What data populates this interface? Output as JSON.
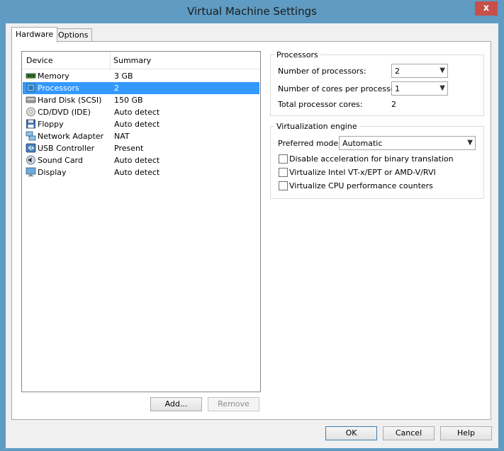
{
  "window": {
    "title": "Virtual Machine Settings",
    "close_glyph": "x"
  },
  "tabs": [
    {
      "label": "Hardware"
    },
    {
      "label": "Options"
    }
  ],
  "device_list": {
    "col_device": "Device",
    "col_summary": "Summary",
    "rows": [
      {
        "device": "Memory",
        "summary": "3 GB",
        "icon": "memory-icon"
      },
      {
        "device": "Processors",
        "summary": "2",
        "icon": "processor-icon"
      },
      {
        "device": "Hard Disk (SCSI)",
        "summary": "150 GB",
        "icon": "hard-disk-icon"
      },
      {
        "device": "CD/DVD (IDE)",
        "summary": "Auto detect",
        "icon": "cd-dvd-icon"
      },
      {
        "device": "Floppy",
        "summary": "Auto detect",
        "icon": "floppy-icon"
      },
      {
        "device": "Network Adapter",
        "summary": "NAT",
        "icon": "network-adapter-icon"
      },
      {
        "device": "USB Controller",
        "summary": "Present",
        "icon": "usb-icon"
      },
      {
        "device": "Sound Card",
        "summary": "Auto detect",
        "icon": "sound-card-icon"
      },
      {
        "device": "Display",
        "summary": "Auto detect",
        "icon": "display-icon"
      }
    ],
    "selected": "Processors"
  },
  "list_buttons": {
    "add": "Add...",
    "remove": "Remove"
  },
  "processors": {
    "title": "Processors",
    "num_processors_label": "Number of processors:",
    "num_processors_value": "2",
    "cores_label": "Number of cores per processor:",
    "cores_value": "1",
    "total_label": "Total processor cores:",
    "total_value": "2"
  },
  "virtualization": {
    "title": "Virtualization engine",
    "mode_label": "Preferred mode:",
    "mode_value": "Automatic",
    "opt1": "Disable acceleration for binary translation",
    "opt2": "Virtualize Intel VT-x/EPT or AMD-V/RVI",
    "opt3": "Virtualize CPU performance counters"
  },
  "footer": {
    "ok": "OK",
    "cancel": "Cancel",
    "help": "Help"
  },
  "colors": {
    "selection": "#3399ff",
    "titlebar": "#5f9bc2",
    "close": "#c7504a"
  }
}
